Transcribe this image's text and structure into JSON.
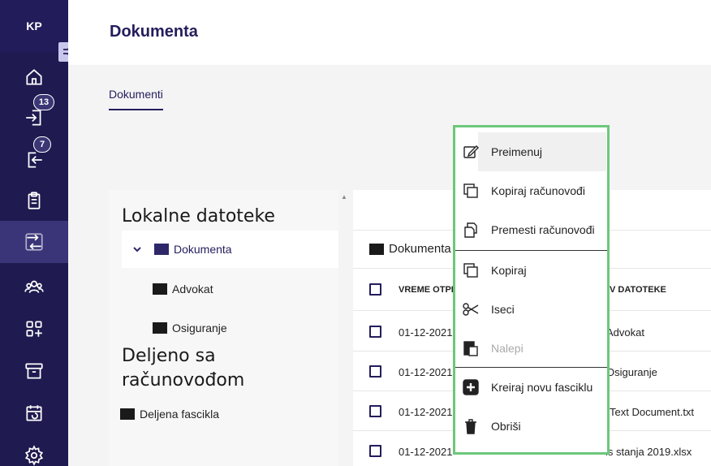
{
  "sidebar": {
    "initials": "KP",
    "badges": {
      "inbox": "13",
      "outbox": "7"
    }
  },
  "header": {
    "title": "Dokumenta"
  },
  "tabs": [
    {
      "label": "Dokumenti"
    }
  ],
  "tree": {
    "local_heading": "Lokalne datoteke",
    "local_items": [
      {
        "label": "Dokumenta"
      },
      {
        "label": "Advokat"
      },
      {
        "label": "Osiguranje"
      }
    ],
    "shared_heading_line1": "Deljeno sa",
    "shared_heading_line2": "računovođom",
    "shared_items": [
      {
        "label": "Deljena fascikla"
      }
    ]
  },
  "table": {
    "breadcrumb": "Dokumenta",
    "columns": [
      "VREME OTPR",
      "V DATOTEKE"
    ],
    "rows": [
      {
        "date": "01-12-2021",
        "name": "Advokat"
      },
      {
        "date": "01-12-2021",
        "name": "Osiguranje"
      },
      {
        "date": "01-12-2021",
        "name": "Text Document.txt"
      },
      {
        "date": "01-12-2021",
        "name": "ls stanja 2019.xlsx"
      }
    ]
  },
  "context_menu": {
    "items": [
      {
        "label": "Preimenuj",
        "icon": "edit-icon"
      },
      {
        "label": "Kopiraj računovođi",
        "icon": "copy-icon"
      },
      {
        "label": "Premesti računovođi",
        "icon": "move-icon"
      },
      {
        "label": "Kopiraj",
        "icon": "copy-icon"
      },
      {
        "label": "Iseci",
        "icon": "scissors-icon"
      },
      {
        "label": "Nalepi",
        "icon": "paste-icon"
      },
      {
        "label": "Kreiraj novu fasciklu",
        "icon": "plus-box-icon"
      },
      {
        "label": "Obriši",
        "icon": "trash-icon"
      }
    ]
  },
  "colors": {
    "sidebar_bg": "#1f1a4f",
    "accent": "#231d5c",
    "menu_border": "#6cc87c"
  }
}
